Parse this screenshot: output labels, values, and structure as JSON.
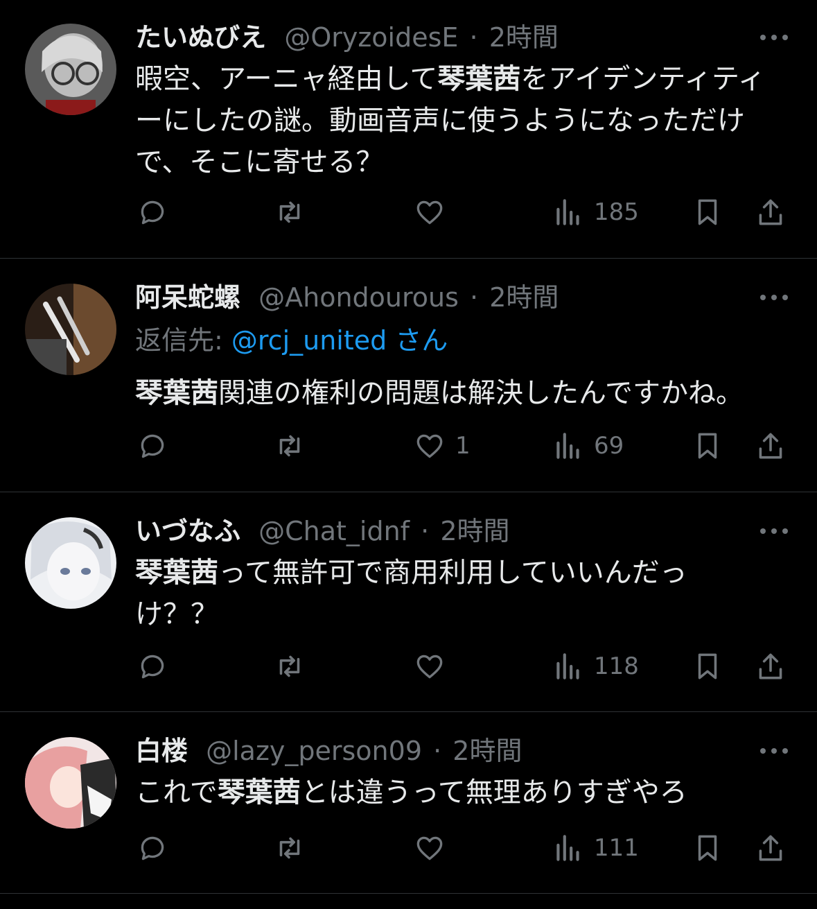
{
  "tweets": [
    {
      "name": "たいぬびえ",
      "handle": "@OryzoidesE",
      "sep": "·",
      "time": "2時間",
      "text_segments": [
        {
          "t": "暇空、アーニャ経由して",
          "b": false
        },
        {
          "t": "琴葉茜",
          "b": true
        },
        {
          "t": "をアイデンティティーにしたの謎。動画音声に使うようになっただけで、そこに寄せる？",
          "b": false
        }
      ],
      "replies": "",
      "retweets": "",
      "likes": "",
      "views": "185"
    },
    {
      "name": "阿呆蛇螺",
      "handle": "@Ahondourous",
      "sep": "·",
      "time": "2時間",
      "reply_to_prefix": "返信先: ",
      "reply_to_handle": "@rcj_united",
      "reply_to_suffix": " さん",
      "text_segments": [
        {
          "t": "琴葉茜",
          "b": true
        },
        {
          "t": "関連の権利の問題は解決したんですかね。",
          "b": false
        }
      ],
      "replies": "",
      "retweets": "",
      "likes": "1",
      "views": "69"
    },
    {
      "name": "いづなふ",
      "handle": "@Chat_idnf",
      "sep": "·",
      "time": "2時間",
      "text_segments": [
        {
          "t": "琴葉茜",
          "b": true
        },
        {
          "t": "って無許可で商用利用していいんだっけ？？",
          "b": false
        }
      ],
      "replies": "",
      "retweets": "",
      "likes": "",
      "views": "118"
    },
    {
      "name": "白楼",
      "handle": "@lazy_person09",
      "sep": "·",
      "time": "2時間",
      "text_segments": [
        {
          "t": "これで",
          "b": false
        },
        {
          "t": "琴葉茜",
          "b": true
        },
        {
          "t": "とは違うって無理ありすぎやろ",
          "b": false
        }
      ],
      "replies": "",
      "retweets": "",
      "likes": "",
      "views": "111"
    }
  ],
  "colors": {
    "background": "#000000",
    "text": "#e7e9ea",
    "secondary": "#71767b",
    "mention": "#1d9bf0",
    "divider": "#2f3336"
  },
  "icons": {
    "reply": "reply-icon",
    "retweet": "retweet-icon",
    "like": "like-icon",
    "views": "views-icon",
    "bookmark": "bookmark-icon",
    "share": "share-icon",
    "more": "more-icon"
  }
}
